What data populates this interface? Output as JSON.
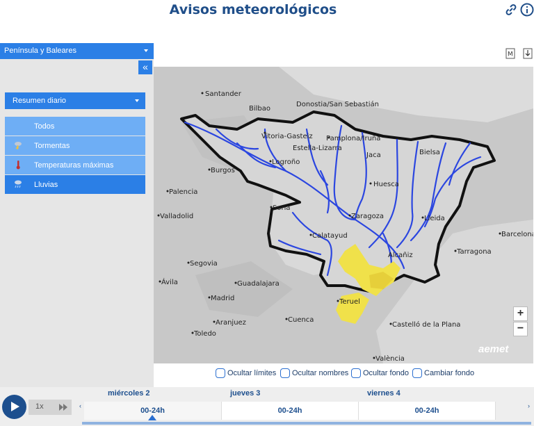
{
  "header": {
    "title": "Avisos meteorológicos"
  },
  "sidebar": {
    "region": "Península y Baleares",
    "collapse_label": "«",
    "summary": "Resumen diario",
    "filters": [
      {
        "label": "Todos",
        "icon": "none",
        "active": false
      },
      {
        "label": "Tormentas",
        "icon": "storm-icon",
        "active": false
      },
      {
        "label": "Temperaturas máximas",
        "icon": "thermometer-icon",
        "active": false
      },
      {
        "label": "Lluvias",
        "icon": "rain-icon",
        "active": true
      }
    ]
  },
  "map_tools": {
    "measure_label": "M"
  },
  "map": {
    "places": [
      "Santander",
      "Bilbao",
      "Donostia/San Sebastián",
      "Vitoria-Gasteiz",
      "Estella-Lizarra",
      "Pamplona/Iruña",
      "Jaca",
      "Bielsa",
      "Logroño",
      "Burgos",
      "Huesca",
      "Palencia",
      "Soria",
      "Zaragoza",
      "Lleida",
      "Valladolid",
      "Calatayud",
      "Barcelona",
      "Tarragona",
      "Alcañiz",
      "Segovia",
      "Ávila",
      "Guadalajara",
      "Madrid",
      "Teruel",
      "Toledo",
      "Aranjuez",
      "Cuenca",
      "Castelló de la Plana",
      "València"
    ],
    "logo": "aemet",
    "zoom_in": "+",
    "zoom_out": "−",
    "warning_color": "#f0e14a"
  },
  "options": [
    {
      "label": "Ocultar límites",
      "checked": false
    },
    {
      "label": "Ocultar nombres",
      "checked": false
    },
    {
      "label": "Ocultar fondo",
      "checked": false
    },
    {
      "label": "Cambiar fondo",
      "checked": false
    }
  ],
  "timeline": {
    "speed": "1x",
    "prev": "‹",
    "next": "›",
    "days": [
      {
        "name": "miércoles 2",
        "slot": "00-24h",
        "current": true
      },
      {
        "name": "jueves 3",
        "slot": "00-24h",
        "current": false
      },
      {
        "name": "viernes 4",
        "slot": "00-24h",
        "current": false
      }
    ]
  }
}
